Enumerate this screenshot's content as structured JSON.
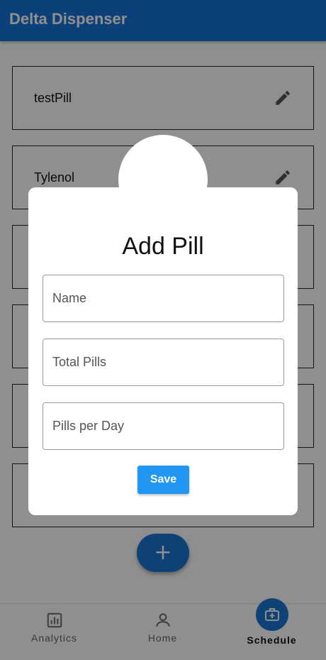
{
  "app": {
    "title": "Delta Dispenser"
  },
  "pills": [
    {
      "name": "testPill",
      "edit_icon": "pencil-icon"
    },
    {
      "name": "Tylenol",
      "edit_icon": "pencil-icon"
    },
    {
      "name": "",
      "edit_icon": "pencil-icon"
    },
    {
      "name": "",
      "edit_icon": "pencil-icon"
    },
    {
      "name": "",
      "edit_icon": "pencil-icon"
    },
    {
      "name": "",
      "edit_icon": "pencil-icon"
    }
  ],
  "fab": {
    "icon": "plus-icon",
    "symbol": "+"
  },
  "dialog": {
    "heading": "Add Pill",
    "fields": {
      "name": {
        "placeholder": "Name",
        "value": ""
      },
      "total_pills": {
        "placeholder": "Total Pills",
        "value": ""
      },
      "pills_per_day": {
        "placeholder": "Pills per Day",
        "value": ""
      }
    },
    "save_label": "Save"
  },
  "bottom_nav": {
    "items": [
      {
        "label": "Analytics",
        "icon": "bar-chart-icon",
        "active": false
      },
      {
        "label": "Home",
        "icon": "person-icon",
        "active": false
      },
      {
        "label": "Schedule",
        "icon": "medical-bag-icon",
        "active": true
      }
    ]
  },
  "colors": {
    "primary": "#1673d6",
    "fab": "#1976d2",
    "save_button": "#2196f3"
  }
}
